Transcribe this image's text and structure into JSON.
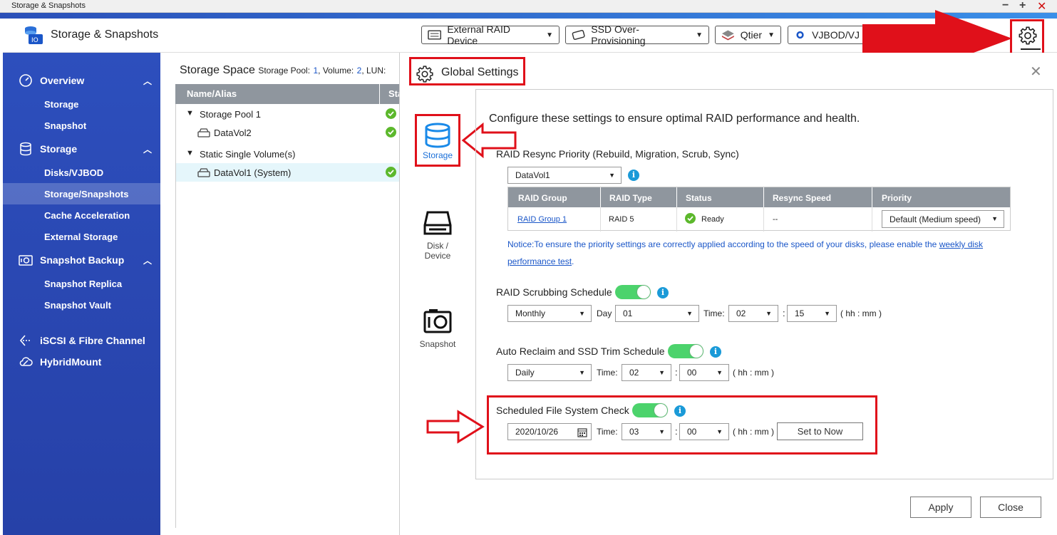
{
  "window": {
    "title": "Storage & Snapshots",
    "min": "−",
    "max": "+",
    "close": "✕"
  },
  "header": {
    "app_title": "Storage & Snapshots",
    "buttons": [
      {
        "label": "External RAID Device"
      },
      {
        "label": "SSD Over-Provisioning"
      },
      {
        "label": "Qtier"
      },
      {
        "label": "VJBOD/VJ"
      }
    ]
  },
  "sidebar": {
    "overview": {
      "label": "Overview",
      "items": [
        "Storage",
        "Snapshot"
      ]
    },
    "storage": {
      "label": "Storage",
      "items": [
        "Disks/VJBOD",
        "Storage/Snapshots",
        "Cache Acceleration",
        "External Storage"
      ]
    },
    "backup": {
      "label": "Snapshot Backup",
      "items": [
        "Snapshot Replica",
        "Snapshot Vault"
      ]
    },
    "iscsi": {
      "label": "iSCSI & Fibre Channel"
    },
    "hybrid": {
      "label": "HybridMount"
    }
  },
  "main": {
    "title": "Storage Space",
    "pool_label": "Storage Pool:",
    "pool_count": "1",
    "volume_label": ", Volume:",
    "volume_count": "2",
    "lun_label": ", LUN:",
    "col_name": "Name/Alias",
    "col_status": "Sta",
    "rows": [
      "Storage Pool 1",
      "DataVol2",
      "Static Single Volume(s)",
      "DataVol1 (System)"
    ]
  },
  "dialog": {
    "title": "Global Settings",
    "tabs": {
      "storage": "Storage",
      "disk": "Disk / Device",
      "snapshot": "Snapshot"
    },
    "intro": "Configure these settings to ensure optimal RAID performance and health.",
    "resync": {
      "label": "RAID Resync Priority (Rebuild, Migration, Scrub, Sync)",
      "volume": "DataVol1",
      "headers": [
        "RAID Group",
        "RAID Type",
        "Status",
        "Resync Speed",
        "Priority"
      ],
      "row": {
        "group": "RAID Group 1",
        "type": "RAID 5",
        "status": "Ready",
        "speed": "--",
        "priority": "Default (Medium speed)"
      },
      "notice_pre": "Notice:To ensure the priority settings are correctly applied according to the speed of your disks, please enable the",
      "notice_link": "weekly disk performance test",
      "notice_post": "."
    },
    "scrub": {
      "label": "RAID Scrubbing Schedule",
      "freq": "Monthly",
      "day_label": "Day",
      "day": "01",
      "time_label": "Time:",
      "hour": "02",
      "minute": "15",
      "hint": "( hh : mm )"
    },
    "trim": {
      "label": "Auto Reclaim and SSD Trim Schedule",
      "freq": "Daily",
      "time_label": "Time:",
      "hour": "02",
      "minute": "00",
      "hint": "( hh : mm )"
    },
    "fscheck": {
      "label": "Scheduled File System Check",
      "date": "2020/10/26",
      "time_label": "Time:",
      "hour": "03",
      "minute": "00",
      "hint": "( hh : mm )",
      "set_now": "Set to Now"
    },
    "apply": "Apply",
    "close": "Close"
  }
}
